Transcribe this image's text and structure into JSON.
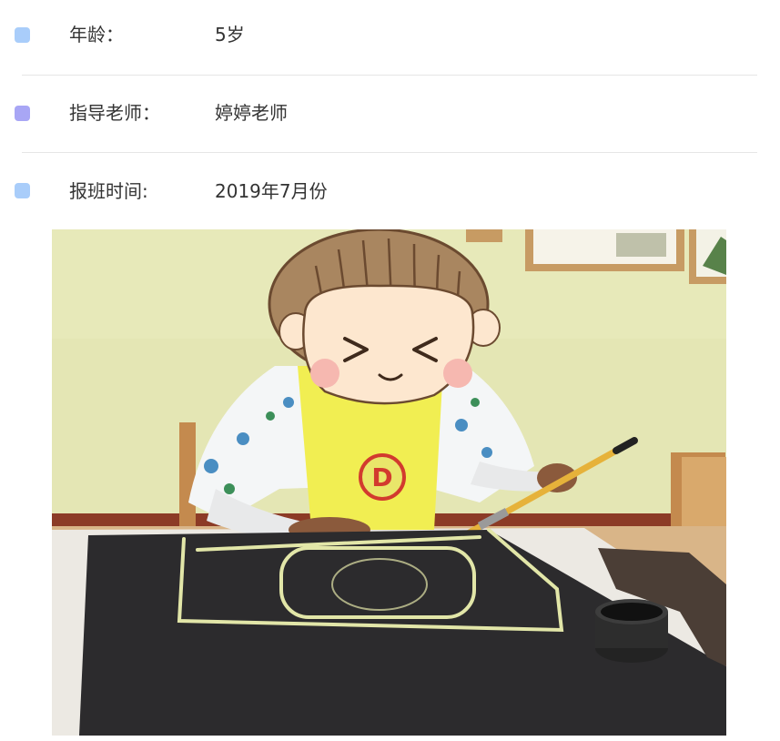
{
  "colors": {
    "bullet_blue": "#a9cdfa",
    "bullet_purple": "#a8a6f5",
    "divider": "#e6e6e6",
    "text": "#333333"
  },
  "info": {
    "age": {
      "label": "年龄：",
      "value": "5岁"
    },
    "teacher": {
      "label": "指导老师：",
      "value": "婷婷老师"
    },
    "enroll": {
      "label": "报班时间:",
      "value": "2019年7月份"
    }
  },
  "photo": {
    "emblem_letter": "D"
  }
}
